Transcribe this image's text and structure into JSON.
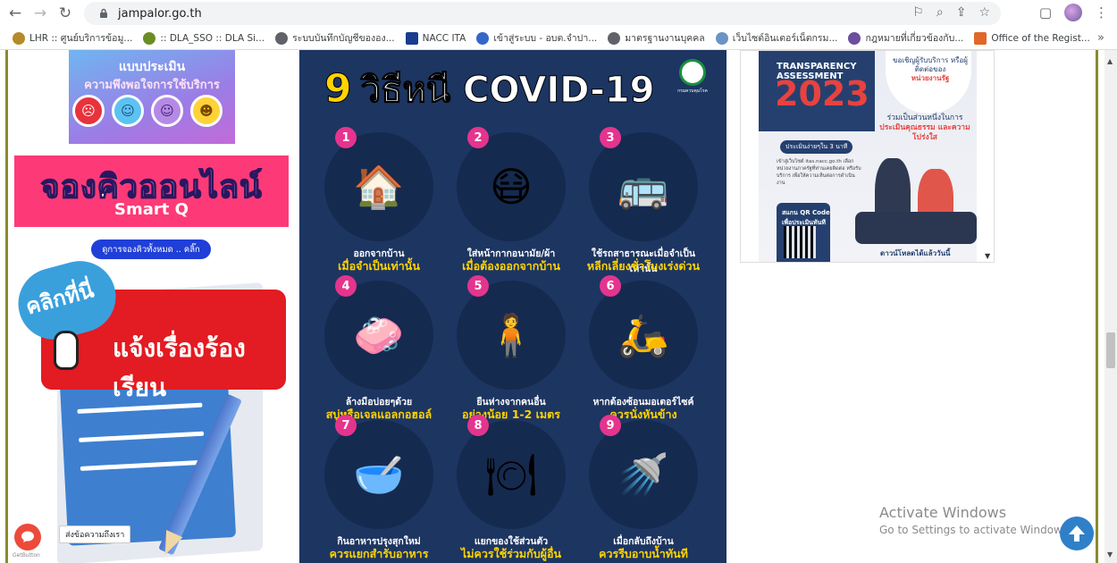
{
  "browser": {
    "url": "jampalor.go.th",
    "bookmarks": [
      {
        "label": "LHR :: ศูนย์บริการข้อมู...",
        "color": "#b58a2a"
      },
      {
        "label": ":: DLA_SSO :: DLA Si...",
        "color": "#6b8e23"
      },
      {
        "label": "ระบบบันทึกบัญชีขององ...",
        "color": "#5f6368"
      },
      {
        "label": "NACC ITA",
        "color": "#1a3c8f"
      },
      {
        "label": "เข้าสู่ระบบ - อบต.จำปา...",
        "color": "#3567c8"
      },
      {
        "label": "มาตรฐานงานบุคคล",
        "color": "#5f6368"
      },
      {
        "label": "เว็บไซต์อินเตอร์เน็ตกรม...",
        "color": "#6a93c6"
      },
      {
        "label": "กฎหมายที่เกี่ยวข้องกับ...",
        "color": "#6b4ea0"
      },
      {
        "label": "Office of the Regist...",
        "color": "#e0672a"
      }
    ],
    "more": "»"
  },
  "left": {
    "survey_title": "แบบประเมิน",
    "survey_sub": "ความพึงพอใจการใช้บริการ",
    "queue_title": "จองคิวออนไลน์",
    "queue_sub": "Smart Q",
    "queue_button": "ดูการจองคิวทั้งหมด .. คลิ๊ก",
    "complaint_click": "คลิกที่นี่",
    "complaint_label": "แจ้งเรื่องร้องเรียน",
    "chat_label": "ส่งข้อความถึงเรา",
    "getbutton": "GetButton"
  },
  "poster": {
    "title_num": "9",
    "title_main": "วิธีหนี COVID-19",
    "logo_text": "กรมควบคุมโรค",
    "tips": [
      {
        "n": "1",
        "icon": "🏠",
        "l1": "ออกจากบ้าน",
        "l2": "เมื่อจำเป็นเท่านั้น"
      },
      {
        "n": "2",
        "icon": "😷",
        "l1": "ใส่หน้ากากอนามัย/ผ้า",
        "l2": "เมื่อต้องออกจากบ้าน"
      },
      {
        "n": "3",
        "icon": "🚌",
        "l1": "ใช้รถสาธารณะเมื่อจำเป็นเท่านั้น",
        "l2": "หลีกเลี่ยงชั่วโมงเร่งด่วน"
      },
      {
        "n": "4",
        "icon": "🧼",
        "l1": "ล้างมือบ่อยๆด้วย",
        "l2": "สบู่หรือเจลแอลกอฮอล์"
      },
      {
        "n": "5",
        "icon": "🧍",
        "l1": "ยืนห่างจากคนอื่น",
        "l2": "อย่างน้อย 1-2 เมตร"
      },
      {
        "n": "6",
        "icon": "🛵",
        "l1": "หากต้องซ้อนมอเตอร์ไซค์",
        "l2": "ควรนั่งหันข้าง"
      },
      {
        "n": "7",
        "icon": "🥣",
        "l1": "กินอาหารปรุงสุกใหม่",
        "l2": "ควรแยกสำรับอาหาร"
      },
      {
        "n": "8",
        "icon": "🍽",
        "l1": "แยกของใช้ส่วนตัว",
        "l2": "ไม่ควรใช้ร่วมกับผู้อื่น"
      },
      {
        "n": "9",
        "icon": "🚿",
        "l1": "เมื่อกลับถึงบ้าน",
        "l2": "ควรรีบอาบน้ำทันที"
      }
    ]
  },
  "ita": {
    "assessment": "TRANSPARENCY ASSESSMENT",
    "year": "2023",
    "invite": "ขอเชิญผู้รับบริการ หรือผู้ติดต่อของ",
    "invite_red": "หน่วยงานรัฐ",
    "join": "ร่วมเป็นส่วนหนึ่งในการ",
    "join_red": "ประเมินคุณธรรม และความโปร่งใส",
    "pill": "ประเมินง่ายๆใน 3 นาที",
    "small": "เข้าสู่เว็บไซต์ itas.nacc.go.th เลือกหน่วยงานภาครัฐที่ท่านเคยติดต่อ หรือรับบริการ เพื่อให้ความเห็นต่อการดำเนินงาน",
    "qr_label": "สแกน QR Code เพื่อประเมินทันที",
    "download": "ดาวน์โหลดได้แล้ววันนี้"
  },
  "watermark": {
    "line1": "Activate Windows",
    "line2": "Go to Settings to activate Windows."
  }
}
